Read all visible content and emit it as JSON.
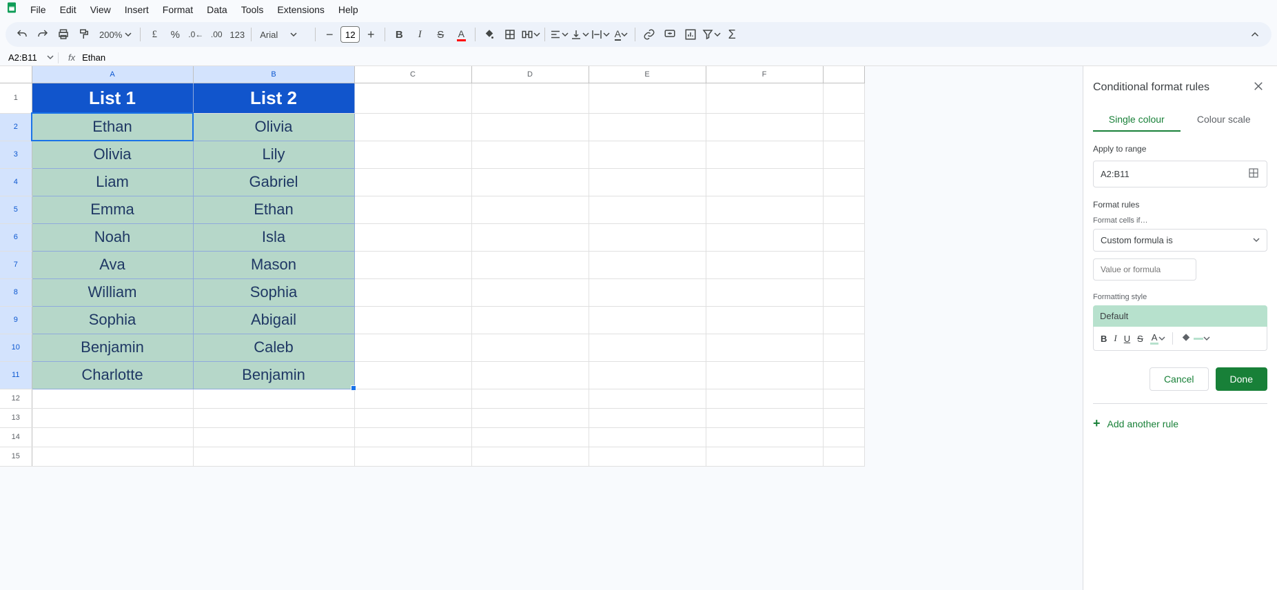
{
  "menu": {
    "items": [
      "File",
      "Edit",
      "View",
      "Insert",
      "Format",
      "Data",
      "Tools",
      "Extensions",
      "Help"
    ]
  },
  "toolbar": {
    "zoom": "200%",
    "font": "Arial",
    "font_size": "12"
  },
  "formula_bar": {
    "name_box": "A2:B11",
    "fx": "fx",
    "value": "Ethan"
  },
  "columns": [
    "A",
    "B",
    "C",
    "D",
    "E",
    "F"
  ],
  "rows": [
    1,
    2,
    3,
    4,
    5,
    6,
    7,
    8,
    9,
    10,
    11,
    12,
    13,
    14,
    15
  ],
  "headers": {
    "A": "List 1",
    "B": "List 2"
  },
  "listA": [
    "Ethan",
    "Olivia",
    "Liam",
    "Emma",
    "Noah",
    "Ava",
    "William",
    "Sophia",
    "Benjamin",
    "Charlotte"
  ],
  "listB": [
    "Olivia",
    "Lily",
    "Gabriel",
    "Ethan",
    "Isla",
    "Mason",
    "Sophia",
    "Abigail",
    "Caleb",
    "Benjamin"
  ],
  "sidebar": {
    "title": "Conditional format rules",
    "tab1": "Single colour",
    "tab2": "Colour scale",
    "apply_label": "Apply to range",
    "range": "A2:B11",
    "rules_label": "Format rules",
    "cells_if_label": "Format cells if…",
    "rule_type": "Custom formula is",
    "formula_placeholder": "Value or formula",
    "style_label": "Formatting style",
    "default_text": "Default",
    "cancel": "Cancel",
    "done": "Done",
    "add_rule": "Add another rule"
  }
}
